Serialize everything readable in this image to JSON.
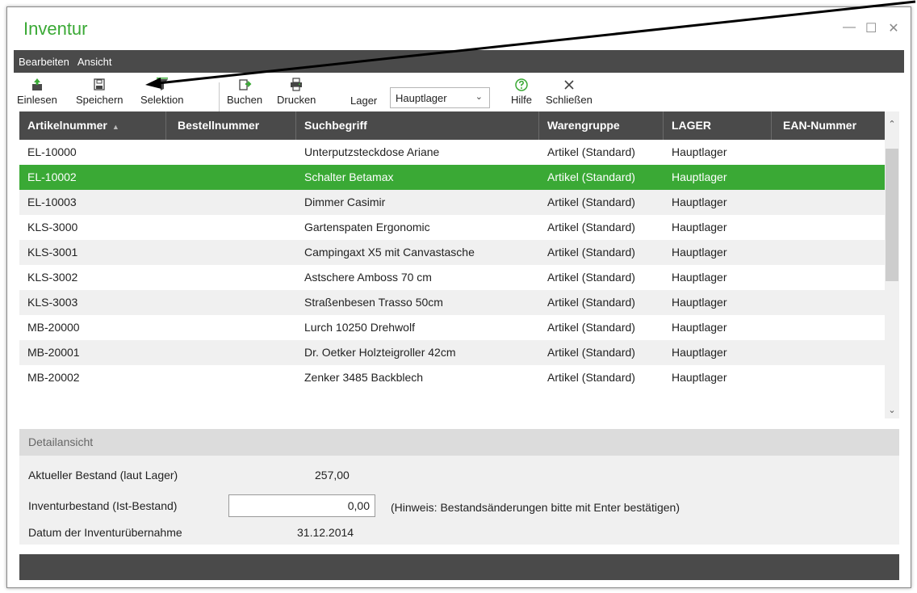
{
  "window": {
    "title": "Inventur",
    "controls": [
      "—",
      "☐",
      "✕"
    ]
  },
  "menu": {
    "items": [
      "Bearbeiten",
      "Ansicht"
    ]
  },
  "toolbar": {
    "einlesen": "Einlesen",
    "speichern": "Speichern",
    "selektion": "Selektion",
    "buchen": "Buchen",
    "drucken": "Drucken",
    "lager_label": "Lager",
    "lager_value": "Hauptlager",
    "hilfe": "Hilfe",
    "schliessen": "Schließen"
  },
  "table": {
    "columns": [
      "Artikelnummer",
      "Bestellnummer",
      "Suchbegriff",
      "Warengruppe",
      "LAGER",
      "EAN-Nummer"
    ],
    "sort_indicator": "▲",
    "rows": [
      [
        "EL-10000",
        "",
        "Unterputzsteckdose Ariane",
        "Artikel (Standard)",
        "Hauptlager",
        ""
      ],
      [
        "EL-10002",
        "",
        "Schalter Betamax",
        "Artikel (Standard)",
        "Hauptlager",
        ""
      ],
      [
        "EL-10003",
        "",
        "Dimmer Casimir",
        "Artikel (Standard)",
        "Hauptlager",
        ""
      ],
      [
        "KLS-3000",
        "",
        "Gartenspaten Ergonomic",
        "Artikel (Standard)",
        "Hauptlager",
        ""
      ],
      [
        "KLS-3001",
        "",
        "Campingaxt X5 mit Canvastasche",
        "Artikel (Standard)",
        "Hauptlager",
        ""
      ],
      [
        "KLS-3002",
        "",
        "Astschere Amboss 70 cm",
        "Artikel (Standard)",
        "Hauptlager",
        ""
      ],
      [
        "KLS-3003",
        "",
        "Straßenbesen Trasso 50cm",
        "Artikel (Standard)",
        "Hauptlager",
        ""
      ],
      [
        "MB-20000",
        "",
        "Lurch 10250 Drehwolf",
        "Artikel (Standard)",
        "Hauptlager",
        ""
      ],
      [
        "MB-20001",
        "",
        "Dr. Oetker Holzteigroller 42cm",
        "Artikel (Standard)",
        "Hauptlager",
        ""
      ],
      [
        "MB-20002",
        "",
        "Zenker 3485 Backblech",
        "Artikel (Standard)",
        "Hauptlager",
        ""
      ]
    ],
    "selected_index": 1
  },
  "detail": {
    "header": "Detailansicht",
    "current_stock_label": "Aktueller Bestand (laut Lager)",
    "current_stock_value": "257,00",
    "inventory_stock_label": "Inventurbestand (Ist-Bestand)",
    "inventory_stock_value": "0,00",
    "hint": "(Hinweis: Bestandsänderungen bitte mit Enter bestätigen)",
    "date_label": "Datum der Inventurübernahme",
    "date_value": "31.12.2014"
  },
  "colors": {
    "accent": "#3aa935",
    "bar": "#4a4a4a",
    "alt_row": "#f0f0f0"
  }
}
